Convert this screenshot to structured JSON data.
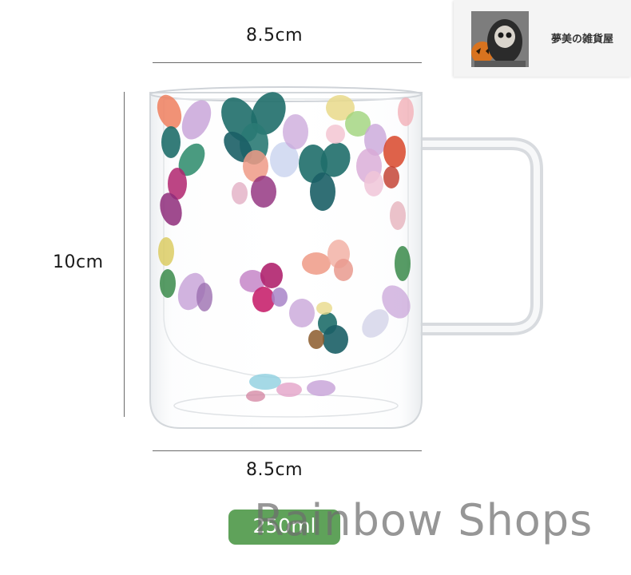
{
  "dimensions": {
    "top_width": "8.5cm",
    "bottom_width": "8.5cm",
    "height": "10cm"
  },
  "capacity": {
    "label": "250ml",
    "color": "#5fa25a"
  },
  "shop": {
    "name": "夢美の雑貨屋"
  },
  "watermark": {
    "text": "Rainbow Shops"
  },
  "colors": {
    "dimension_line": "#6a6a6a",
    "petal_teal": "#1f6e6a",
    "petal_magenta": "#b0246e",
    "petal_lilac": "#c9a6d9",
    "petal_coral": "#ee9a86"
  }
}
